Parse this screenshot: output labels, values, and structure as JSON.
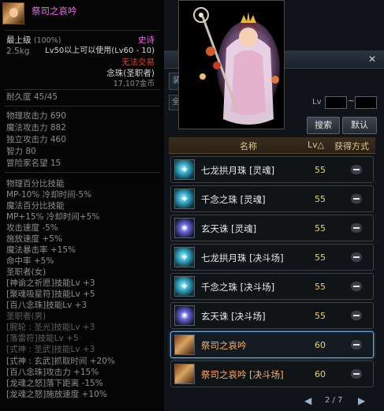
{
  "tooltip": {
    "name": "祭司之哀吟",
    "grade": "最上级",
    "grade_pct": "(100%)",
    "rarity": "史诗",
    "weight": "2.5kg",
    "level_req": "Lv50以上可以使用(Lv60 - 10)",
    "trade": "无法交易",
    "type": "念珠(圣职者)",
    "price": "17,107金币",
    "durability": "耐久度 45/45",
    "stats": [
      "物理攻击力 690",
      "魔法攻击力 882",
      "独立攻击力 460",
      "智力 80",
      "冒险家名望 15"
    ],
    "options": [
      "物理百分比技能",
      " MP-10% 冷却时间-5%",
      "魔法百分比技能",
      " MP+15% 冷却时间+5%",
      "攻击速度 -5%",
      "施放速度 +5%",
      "魔法暴击率 +15%",
      "命中率 +5%"
    ],
    "class_female": "圣职者(女)",
    "female_skills": [
      "[神谕之祈愿]技能Lv +3",
      "[聚魂吸星符]技能Lv +5",
      "[百八念珠]技能Lv +3"
    ],
    "class_male": "圣职者(男)",
    "male_skills": [
      "[腕轮 : 圣光]技能Lv +3",
      "[落雷符]技能Lv +5",
      "[式神 : 圣武]技能Lv +3"
    ],
    "extra": [
      "[式神 : 玄武]抓取时间 +20%",
      "[百八念珠]攻击力 +15%",
      "[龙魂之怒]落下距离 -15%",
      "[龙魂之怒]施放速度 +10%"
    ]
  },
  "window": {
    "close": "✕",
    "tab_stub": "装",
    "filter_stub": "全",
    "lv_label": "Lv",
    "lv_tilde": "~",
    "search_label": "搜索",
    "default_label": "默认"
  },
  "table": {
    "col_name": "名称",
    "col_lv": "Lv△",
    "col_acq": "获得方式",
    "rows": [
      {
        "name": "七龙拱月珠 [灵魂]",
        "lv": "55",
        "icon": "soul",
        "glyph": "✦"
      },
      {
        "name": "千念之珠 [灵魂]",
        "lv": "55",
        "icon": "soul",
        "glyph": "✦"
      },
      {
        "name": "玄天诛 [灵魂]",
        "lv": "55",
        "icon": "xuan",
        "glyph": "✶"
      },
      {
        "name": "七龙拱月珠 [决斗场]",
        "lv": "55",
        "icon": "soul",
        "glyph": "✦"
      },
      {
        "name": "千念之珠 [决斗场]",
        "lv": "55",
        "icon": "soul",
        "glyph": "✦"
      },
      {
        "name": "玄天诛 [决斗场]",
        "lv": "55",
        "icon": "xuan",
        "glyph": "✶"
      },
      {
        "name": "祭司之哀吟",
        "lv": "60",
        "icon": "fem",
        "glyph": ""
      },
      {
        "name": "祭司之哀吟 [决斗场]",
        "lv": "60",
        "icon": "fem",
        "glyph": ""
      }
    ],
    "selected_index": 6
  },
  "pager": {
    "prev": "◀",
    "text": "2 / 7",
    "next": "▶"
  },
  "colors": {
    "epic": "#ff66ff",
    "warning": "#e8402a",
    "level": "#e8d36a",
    "selected": "#7aa8d6"
  }
}
